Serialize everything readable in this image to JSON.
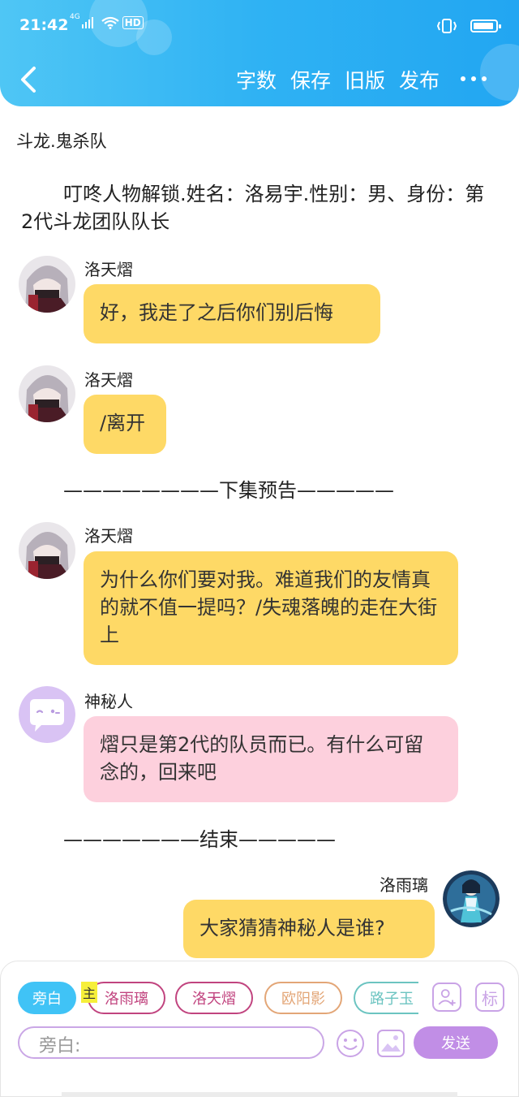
{
  "status": {
    "time": "21:42",
    "network": "4G",
    "wifi_label": "HD",
    "battery_level": 0.92
  },
  "nav": {
    "actions": [
      "字数",
      "保存",
      "旧版",
      "发布"
    ]
  },
  "story": {
    "chapter_title": "斗龙.鬼杀队",
    "narration": "叮咚人物解锁.姓名：洛易宇.性别：男、身份：第2代斗龙团队队长",
    "divider_preview": "————————下集预告—————",
    "divider_end": "———————结束—————"
  },
  "messages": [
    {
      "speaker": "洛天熠",
      "text": "好，我走了之后你们别后悔",
      "avatar_icon": "luotianyi-avatar"
    },
    {
      "speaker": "洛天熠",
      "text": "/离开",
      "avatar_icon": "luotianyi-avatar"
    },
    {
      "speaker": "洛天熠",
      "text": "为什么你们要对我。难道我们的友情真的就不值一提吗？/失魂落魄的走在大街上",
      "avatar_icon": "luotianyi-avatar"
    },
    {
      "speaker": "神秘人",
      "text": "熠只是第2代的队员而已。有什么可留念的，回来吧",
      "avatar_icon": "chat-bubble-avatar"
    },
    {
      "speaker": "洛雨璃",
      "text": "大家猜猜神秘人是谁?",
      "avatar_icon": "luoyuli-avatar"
    }
  ],
  "composer": {
    "roles": [
      {
        "label": "旁白",
        "color": "#40c3f6"
      },
      {
        "label": "洛雨璃",
        "color": "#c1447f"
      },
      {
        "label": "洛天熠",
        "color": "#c1447f"
      },
      {
        "label": "欧阳影",
        "color": "#e3a677"
      },
      {
        "label": "路子玉",
        "color": "#6cc4c1"
      }
    ],
    "main_tag": "主",
    "flag_label": "标",
    "input_placeholder": "旁白:",
    "send_label": "发送"
  }
}
